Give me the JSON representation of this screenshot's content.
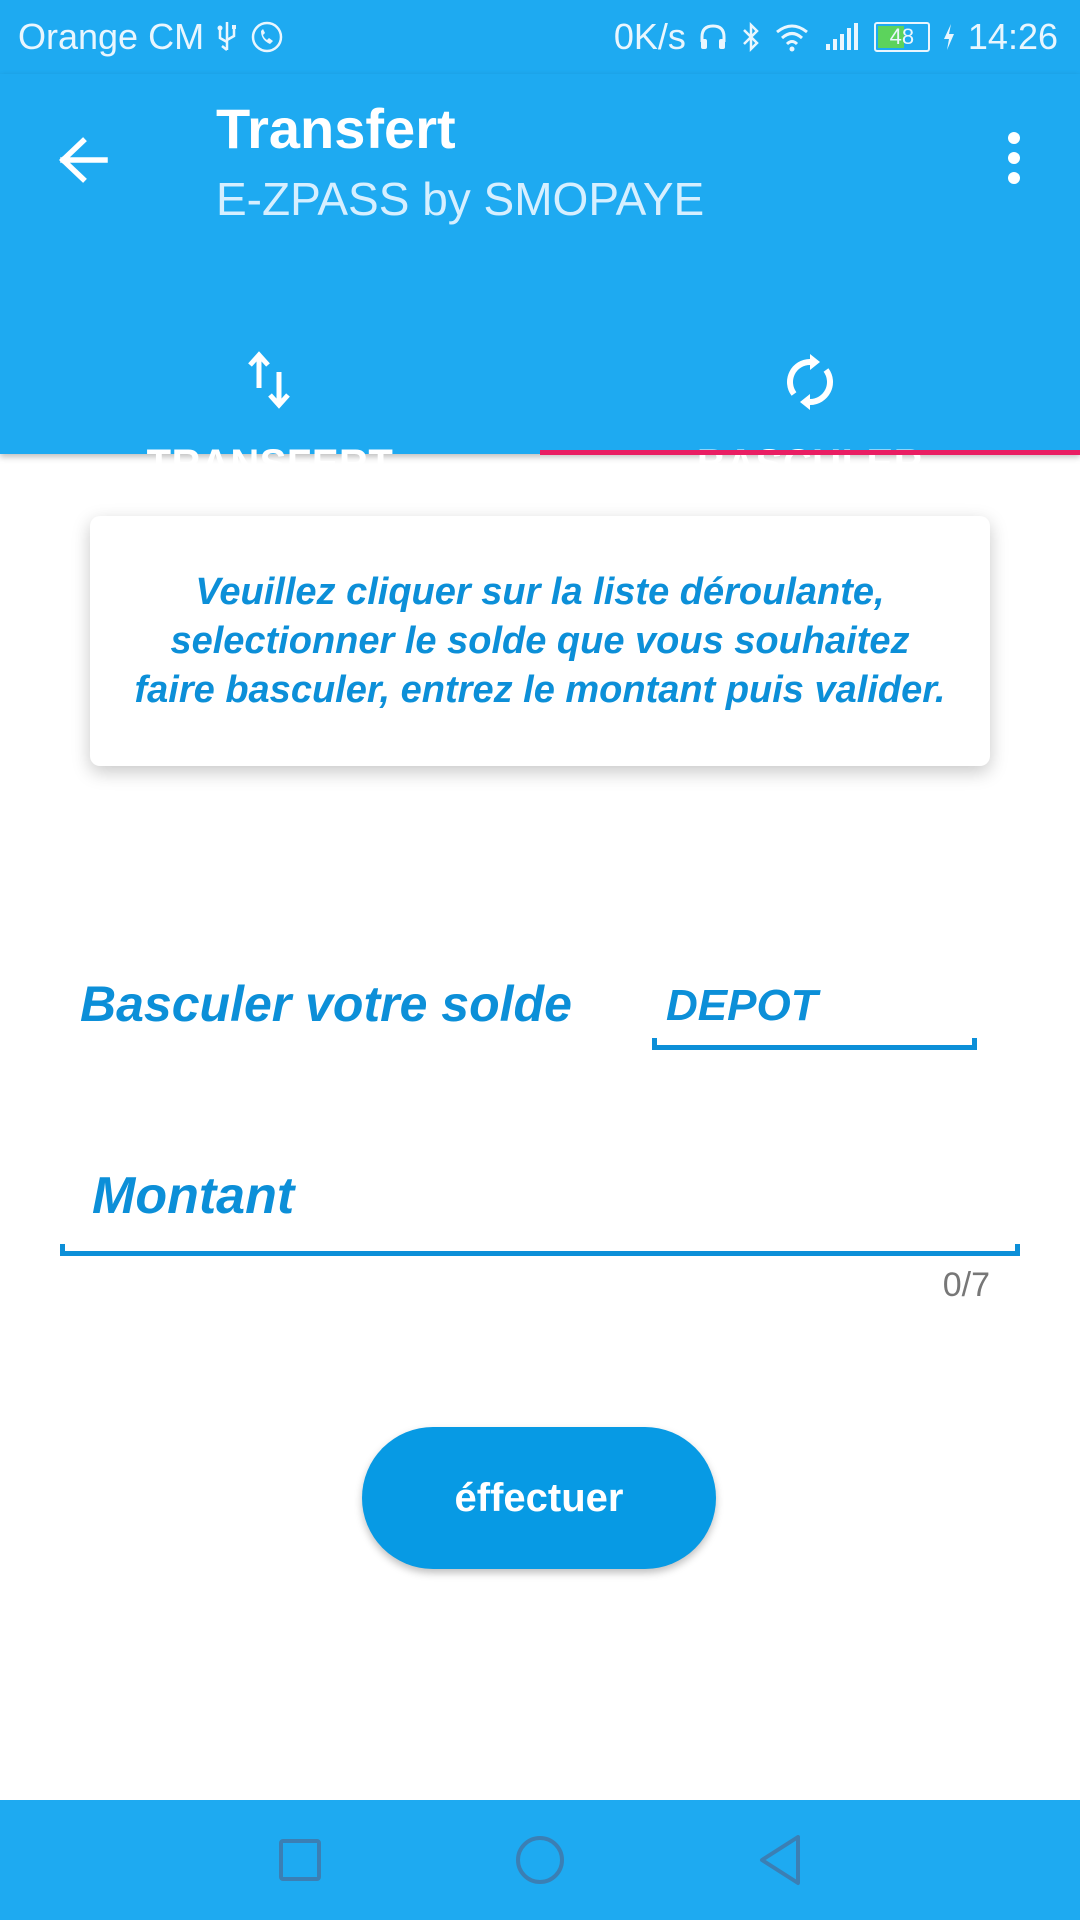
{
  "status_bar": {
    "carrier": "Orange CM",
    "speed": "0K/s",
    "battery": "48",
    "time": "14:26",
    "icons": [
      "usb-icon",
      "whatsapp-icon",
      "headphones-icon",
      "bluetooth-icon",
      "wifi-icon",
      "signal-icon",
      "battery-icon",
      "charging-icon"
    ]
  },
  "app_bar": {
    "title": "Transfert",
    "subtitle": "E-ZPASS by SMOPAYE",
    "icons": [
      "back-arrow-icon",
      "more-vert-icon"
    ]
  },
  "tabs": [
    {
      "label": "TRANSFERT",
      "icon": "swap-vert-icon",
      "selected": false
    },
    {
      "label": "BASCULER",
      "icon": "sync-icon",
      "selected": true
    }
  ],
  "info_card": {
    "line1": "Veuillez cliquer sur la liste déroulante,",
    "line2": "selectionner le solde que vous souhaitez",
    "line3": "faire basculer, entrez le montant puis valider."
  },
  "form": {
    "switch_label": "Basculer votre solde",
    "balance_selected": "DEPOT",
    "amount_placeholder": "Montant",
    "amount_value": "",
    "counter": "0/7",
    "submit_label": "éffectuer"
  },
  "colors": {
    "primary": "#1eaaf1",
    "accent_text": "#0c8fd8",
    "button": "#079ae4",
    "tab_indicator": "#e91e63"
  }
}
